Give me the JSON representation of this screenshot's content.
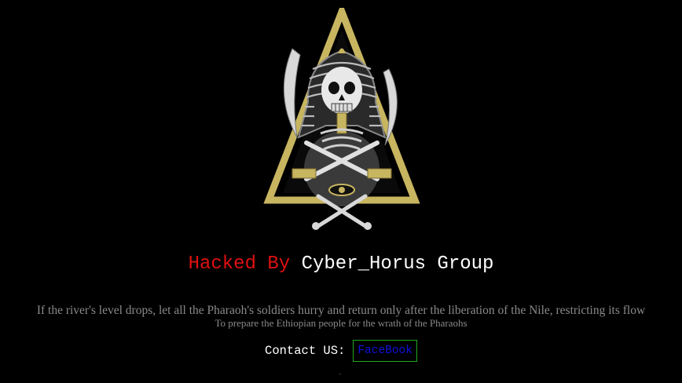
{
  "headline": {
    "prefix": "Hacked By",
    "group": "Cyber_Horus Group"
  },
  "message": {
    "line1": "If the river's level drops, let all the Pharaoh's soldiers hurry and return only after the liberation of the Nile, restricting its flow",
    "line2": "To prepare the Ethiopian people for the wrath of the Pharaohs"
  },
  "contact": {
    "label": "Contact US:",
    "facebook_label": "FaceBook"
  },
  "colors": {
    "background": "#000000",
    "accent_red": "#e01010",
    "gold": "#c8b560",
    "link_blue": "#1010dd",
    "border_green": "#1fa81f"
  },
  "icons": {
    "emblem": "pharaoh-skull-emblem-icon"
  }
}
